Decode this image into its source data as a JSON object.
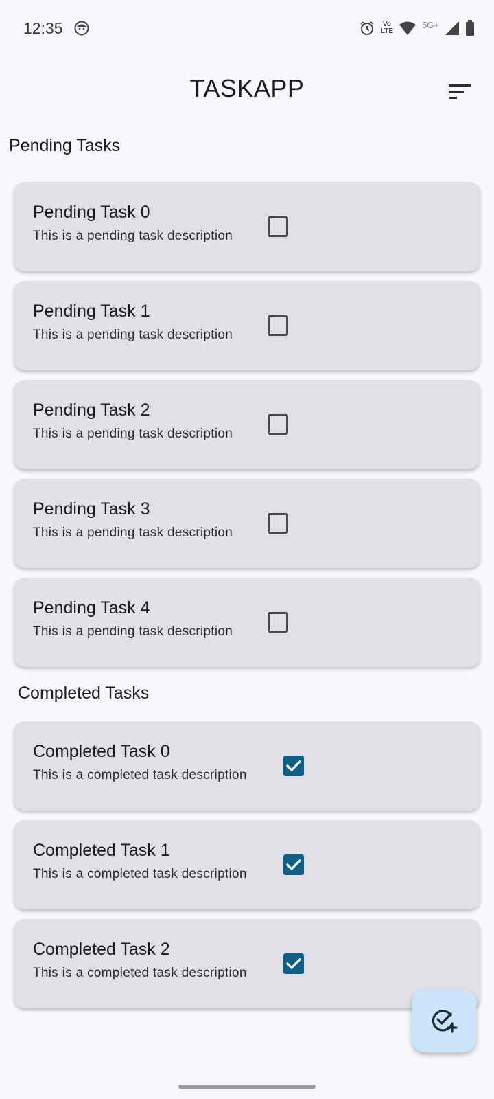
{
  "status_bar": {
    "time": "12:35",
    "volte_top": "Vo",
    "volte_bottom": "LTE",
    "network": "5G+"
  },
  "app_bar": {
    "title": "TASKAPP",
    "sort_icon": "sort-icon"
  },
  "pending": {
    "section_title": "Pending Tasks",
    "tasks": [
      {
        "title": "Pending Task 0",
        "description": "This is a pending task description",
        "checked": false
      },
      {
        "title": "Pending Task 1",
        "description": "This is a pending task description",
        "checked": false
      },
      {
        "title": "Pending Task 2",
        "description": "This is a pending task description",
        "checked": false
      },
      {
        "title": "Pending Task 3",
        "description": "This is a pending task description",
        "checked": false
      },
      {
        "title": "Pending Task 4",
        "description": "This is a pending task description",
        "checked": false
      }
    ]
  },
  "completed": {
    "section_title": "Completed Tasks",
    "tasks": [
      {
        "title": "Completed Task 0",
        "description": "This is a completed task description",
        "checked": true
      },
      {
        "title": "Completed Task 1",
        "description": "This is a completed task description",
        "checked": true
      },
      {
        "title": "Completed Task 2",
        "description": "This is a completed task description",
        "checked": true
      }
    ]
  },
  "fab": {
    "icon": "add-task-icon"
  },
  "colors": {
    "background": "#f6f8fc",
    "card": "#dfe1e6",
    "checkbox_checked": "#0e5e86",
    "fab": "#cde5fb"
  }
}
